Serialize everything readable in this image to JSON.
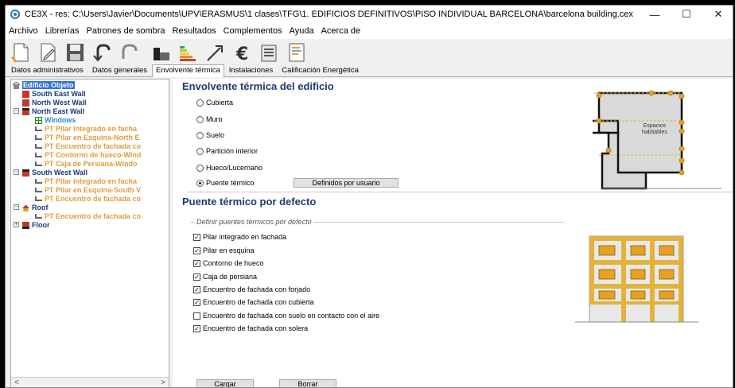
{
  "window": {
    "title": "CE3X - res: C:\\Users\\Javier\\Documents\\UPV\\ERASMUS\\1 clases\\TFG\\1. EDIFICIOS DEFINITIVOS\\PISO INDIVIDUAL BARCELONA\\barcelona building.cex",
    "minimize": "—",
    "maximize": "☐",
    "close": "✕"
  },
  "menu": [
    "Archivo",
    "Librerías",
    "Patrones de sombra",
    "Resultados",
    "Complementos",
    "Ayuda",
    "Acerca de"
  ],
  "tabs": [
    "Datos administrativos",
    "Datos generales",
    "Envolvente térmica",
    "Instalaciones",
    "Calificación Energética"
  ],
  "active_tab": "Envolvente térmica",
  "tree": {
    "root": "Edificio Objeto",
    "items": [
      "South East Wall",
      "North West Wall",
      "North East Wall",
      "Windows",
      "PT Pilar integrado en facha",
      "PT Pilar en Esquina-North E",
      "PT Encuentro de fachada co",
      "PT Contorno de hueco-Wind",
      "PT Caja de Persiana-Windo",
      "South West Wall",
      "PT Pilar integrado en facha",
      "PT Pilar en Esquina-South V",
      "PT Encuentro de fachada co",
      "Roof",
      "PT Encuentro de fachada co",
      "Floor"
    ],
    "scroll_left": "<",
    "scroll_right": ">"
  },
  "envelope": {
    "title": "Envolvente térmica del edificio",
    "options": [
      "Cubierta",
      "Muro",
      "Suelo",
      "Partición interior",
      "Hueco/Lucernario",
      "Puente térmico"
    ],
    "selected": "Puente térmico",
    "user_defined_button": "Definidos por usuario",
    "diagram_label_line1": "Espacios",
    "diagram_label_line2": "habitables"
  },
  "thermal_bridge": {
    "title": "Puente térmico por defecto",
    "group_label": "Definir puentes térmicos por defecto",
    "checks": [
      {
        "label": "Pilar integrado en fachada",
        "checked": true
      },
      {
        "label": "Pilar en esquina",
        "checked": true
      },
      {
        "label": "Contorno de hueco",
        "checked": true
      },
      {
        "label": "Caja de persiana",
        "checked": true
      },
      {
        "label": "Encuentro de fachada con forjado",
        "checked": true
      },
      {
        "label": "Encuentro de fachada con cubierta",
        "checked": true
      },
      {
        "label": "Encuentro de fachada con suelo en contacto con el aire",
        "checked": false
      },
      {
        "label": "Encuentro de fachada con solera",
        "checked": true
      }
    ],
    "load_button": "Cargar",
    "delete_button": "Borrar"
  },
  "colors": {
    "heading": "#1e3a6e",
    "pt_orange": "#e39b3c",
    "wall_red": "#c0392b",
    "facade_yellow": "#e2b33b"
  }
}
